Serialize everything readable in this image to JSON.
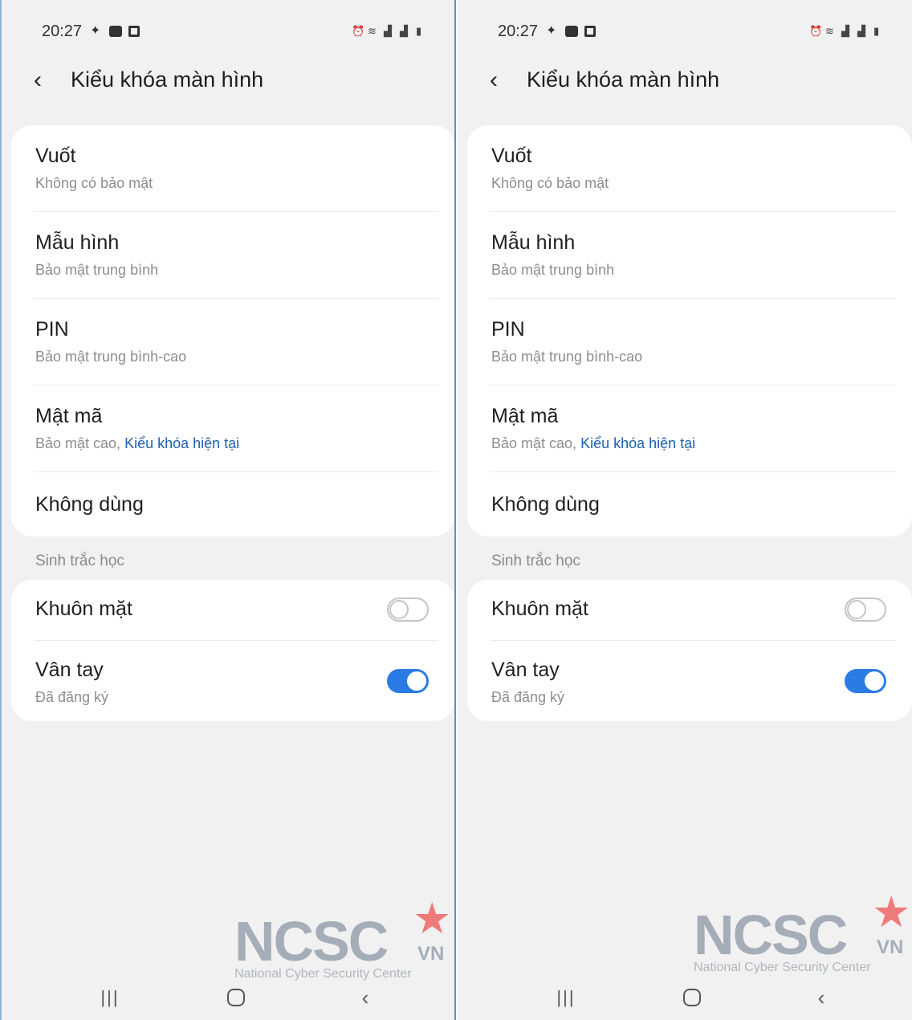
{
  "status_bar": {
    "time": "20:27"
  },
  "header": {
    "back_icon": "‹",
    "title": "Kiểu khóa màn hình"
  },
  "lock_types": [
    {
      "title": "Vuốt",
      "subtitle": "Không có bảo mật"
    },
    {
      "title": "Mẫu hình",
      "subtitle": "Bảo mật trung bình"
    },
    {
      "title": "PIN",
      "subtitle": "Bảo mật trung bình-cao"
    },
    {
      "title": "Mật mã",
      "subtitle": "Bảo mật cao,",
      "subtitle_highlight": "Kiểu khóa hiện tại"
    },
    {
      "title": "Không dùng"
    }
  ],
  "biometrics": {
    "section_label": "Sinh trắc học",
    "items": [
      {
        "title": "Khuôn mặt",
        "toggle_on": false
      },
      {
        "title": "Vân tay",
        "subtitle": "Đã đăng ký",
        "toggle_on": true
      }
    ]
  },
  "watermark": {
    "logo": "NCSC",
    "logo_suffix": "VN",
    "tagline": "National Cyber Security Center"
  },
  "nav_bar": {
    "recents": "|||",
    "back": "‹"
  },
  "colors": {
    "accent": "#2c7be5",
    "highlight_text": "#1f5fb2",
    "background": "#f1f1f1",
    "card": "#ffffff"
  }
}
